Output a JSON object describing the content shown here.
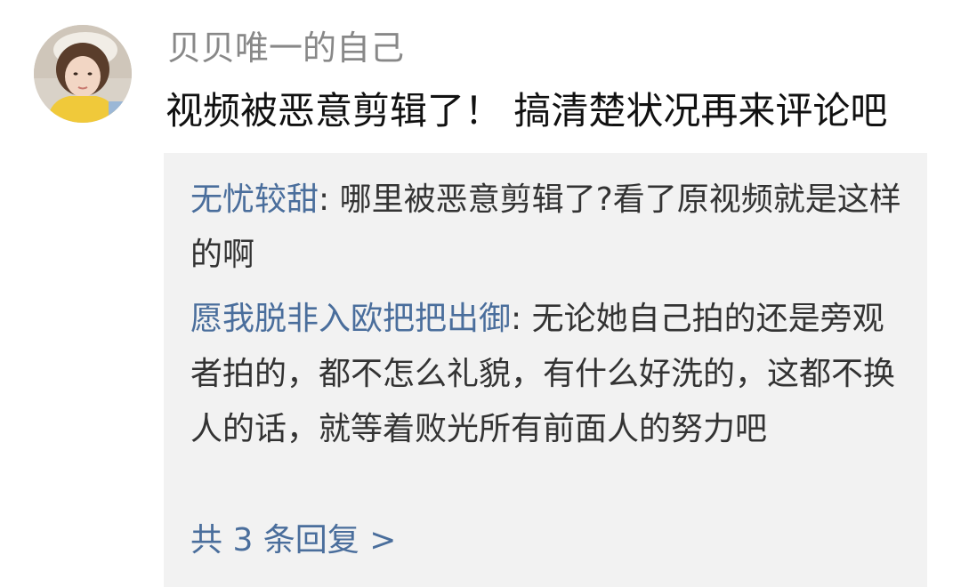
{
  "comment": {
    "username": "贝贝唯一的自己",
    "text": "视频被恶意剪辑了！ 搞清楚状况再来评论吧",
    "avatar_icon": "user-avatar-photo"
  },
  "replies": [
    {
      "user": "无忧较甜",
      "separator": ": ",
      "text": "哪里被恶意剪辑了?看了原视频就是这样的啊"
    },
    {
      "user": "愿我脱非入欧把把出御",
      "separator": ": ",
      "text": "无论她自己拍的还是旁观者拍的，都不怎么礼貌，有什么好洗的，这都不换人的话，就等着败光所有前面人的努力吧"
    }
  ],
  "more_replies_label": "共 3 条回复 >",
  "colors": {
    "username": "#888888",
    "reply_user": "#4a6e9c",
    "reply_box_bg": "#f2f2f2"
  }
}
